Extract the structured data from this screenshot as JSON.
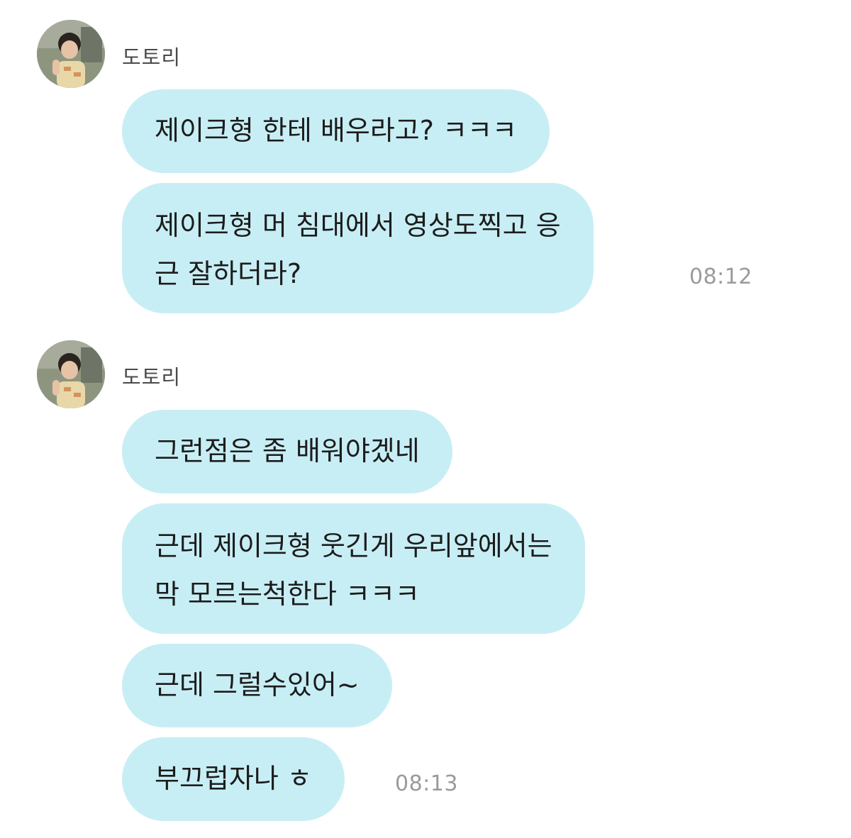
{
  "colors": {
    "bubble": "#c8eef5",
    "text": "#1c1c1c",
    "sender_name": "#4a4a4a",
    "timestamp": "#9a9a9a",
    "background": "#ffffff"
  },
  "groups": [
    {
      "sender": "도토리",
      "avatar_icon": "profile-photo-child",
      "messages": [
        {
          "text": "제이크형 한테 배우라고? ㅋㅋㅋ"
        },
        {
          "text": "제이크형 머 침대에서 영상도찍고 응\n근 잘하더라?"
        }
      ],
      "time": "08:12"
    },
    {
      "sender": "도토리",
      "avatar_icon": "profile-photo-child",
      "messages": [
        {
          "text": "그런점은 좀 배워야겠네"
        },
        {
          "text": "근데 제이크형 웃긴게 우리앞에서는\n막 모르는척한다 ㅋㅋㅋ"
        },
        {
          "text": "근데 그럴수있어~"
        },
        {
          "text": "부끄럽자나 ㅎ"
        }
      ],
      "time": "08:13"
    }
  ]
}
